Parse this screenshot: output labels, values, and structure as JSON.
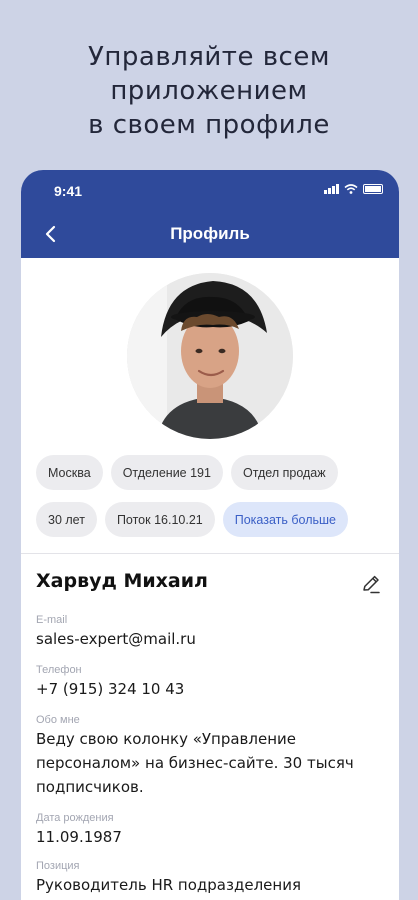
{
  "promo": {
    "line1": "Управляйте всем",
    "line2": "приложением",
    "line3": "в своем профиле"
  },
  "status_bar": {
    "time": "9:41",
    "icons": [
      "signal-icon",
      "wifi-icon",
      "battery-icon"
    ]
  },
  "app_bar": {
    "title": "Профиль",
    "back_icon": "chevron-left-icon"
  },
  "colors": {
    "page_background": "#cdd3e6",
    "app_bar": "#2f4a9b",
    "chip": "#ececef",
    "chip_accent": "#dde6fa",
    "chip_accent_text": "#3a5fc6"
  },
  "tags": {
    "row1": [
      "Москва",
      "Отделение 191",
      "Отдел продаж"
    ],
    "row2": [
      "30 лет",
      "Поток 16.10.21"
    ],
    "more": "Показать больше"
  },
  "profile": {
    "name": "Харвуд Михаил",
    "edit_icon": "pencil-icon",
    "fields": [
      {
        "label": "E-mail",
        "value": "sales-expert@mail.ru"
      },
      {
        "label": "Телефон",
        "value": "+7 (915) 324 10 43"
      },
      {
        "label": "Обо мне",
        "value_lines": [
          "Веду свою колонку «Управление",
          "персоналом» на бизнес-сайте. 30 тысяч",
          "подписчиков."
        ]
      },
      {
        "label": "Дата рождения",
        "value": "11.09.1987"
      },
      {
        "label": "Позиция",
        "value": "Руководитель HR подразделения"
      }
    ]
  }
}
